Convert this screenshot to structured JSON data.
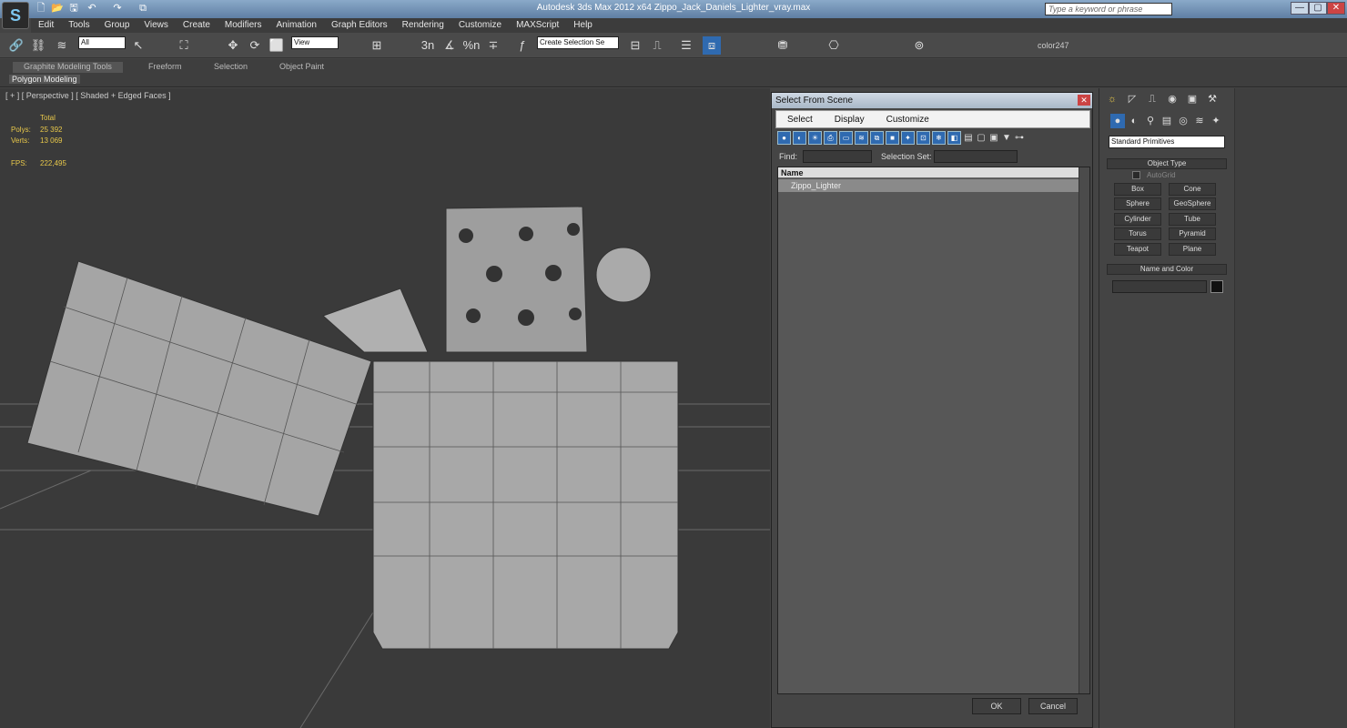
{
  "app": {
    "logo": "S",
    "title": "Autodesk 3ds Max  2012 x64      Zippo_Jack_Daniels_Lighter_vray.max"
  },
  "quick_access": [
    "🗋",
    "📂",
    "🖫",
    "↶",
    "↷",
    "⧉"
  ],
  "search": {
    "placeholder": "Type a keyword or phrase"
  },
  "window_buttons": [
    "—",
    "▢",
    "✕"
  ],
  "menu": [
    "Edit",
    "Tools",
    "Group",
    "Views",
    "Create",
    "Modifiers",
    "Animation",
    "Graph Editors",
    "Rendering",
    "Customize",
    "MAXScript",
    "Help"
  ],
  "toolbar": {
    "filter": "All",
    "ref_coord": "View",
    "named_sel": "Create Selection Se",
    "color_label": "color247",
    "icons": [
      "🔗",
      "⛓",
      "≋",
      "↖",
      "⛶",
      "✥",
      "⟳",
      "⬜",
      "⊞",
      "3n",
      "∡",
      "%n",
      "∓",
      "ƒ",
      "⊟",
      "⎍",
      "☰",
      "⧈",
      "⛃",
      "⎔",
      "⊚"
    ]
  },
  "ribbon": {
    "tabs": [
      "Graphite Modeling Tools",
      "Freeform",
      "Selection",
      "Object Paint"
    ],
    "sub": "Polygon Modeling"
  },
  "viewport": {
    "label": "[ + ] [ Perspective ] [ Shaded + Edged Faces ]",
    "stats": {
      "total_label": "Total",
      "polys_label": "Polys:",
      "polys": "25 392",
      "verts_label": "Verts:",
      "verts": "13 069",
      "fps_label": "FPS:",
      "fps": "222,495"
    }
  },
  "dialog": {
    "title": "Select From Scene",
    "menu": [
      "Select",
      "Display",
      "Customize"
    ],
    "find_label": "Find:",
    "selset_label": "Selection Set:",
    "column": "Name",
    "item": "Zippo_Lighter",
    "ok": "OK",
    "cancel": "Cancel"
  },
  "command_panel": {
    "tabs": [
      "☼",
      "◸",
      "⎍",
      "◉",
      "▣",
      "⚒"
    ],
    "sub_icons": [
      "●",
      "◐",
      "⚲",
      "▤",
      "◎",
      "≋",
      "✦"
    ],
    "dropdown": "Standard Primitives",
    "object_type": "Object Type",
    "autogrid": "AutoGrid",
    "primitives": [
      "Box",
      "Cone",
      "Sphere",
      "GeoSphere",
      "Cylinder",
      "Tube",
      "Torus",
      "Pyramid",
      "Teapot",
      "Plane"
    ],
    "name_color": "Name and Color"
  }
}
